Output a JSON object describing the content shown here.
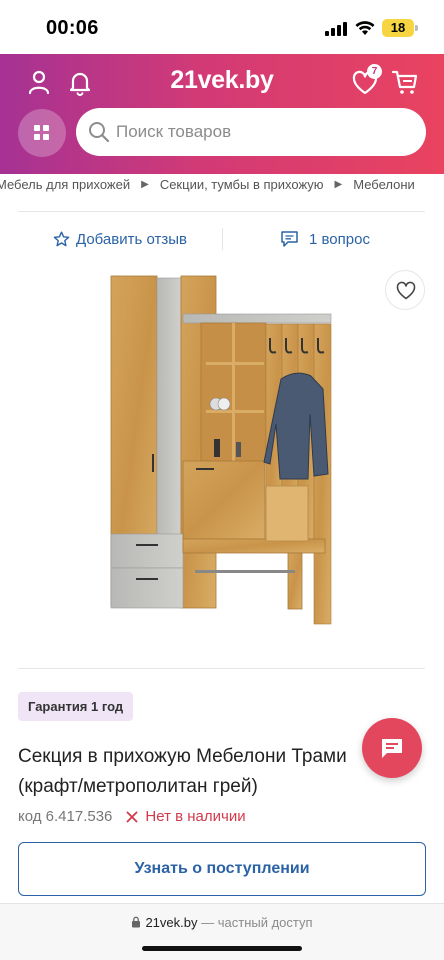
{
  "status_bar": {
    "time": "00:06",
    "battery": "18"
  },
  "header": {
    "logo": "21vek.by",
    "favorites_badge": "7",
    "search_placeholder": "Поиск товаров",
    "gradient_colors": [
      "#a53294",
      "#d23a76",
      "#e9435f"
    ]
  },
  "breadcrumb": {
    "items": [
      "Мебель для прихожей",
      "Секции, тумбы в прихожую",
      "Мебелони"
    ]
  },
  "actions": {
    "review_label": "Добавить отзыв",
    "questions_label": "1 вопрос"
  },
  "product": {
    "warranty": "Гарантия 1 год",
    "title": "Секция в прихожую Мебелони Трами (крафт/метрополитан грей)",
    "code": "код 6.417.536",
    "stock_status": "Нет в наличии",
    "notify_button": "Узнать о поступлении"
  },
  "browser": {
    "domain": "21vek.by",
    "access": "— частный доступ"
  },
  "colors": {
    "accent_blue": "#2b63a6",
    "out_of_stock_red": "#d23a4b",
    "chat_fab": "#e2475d"
  }
}
